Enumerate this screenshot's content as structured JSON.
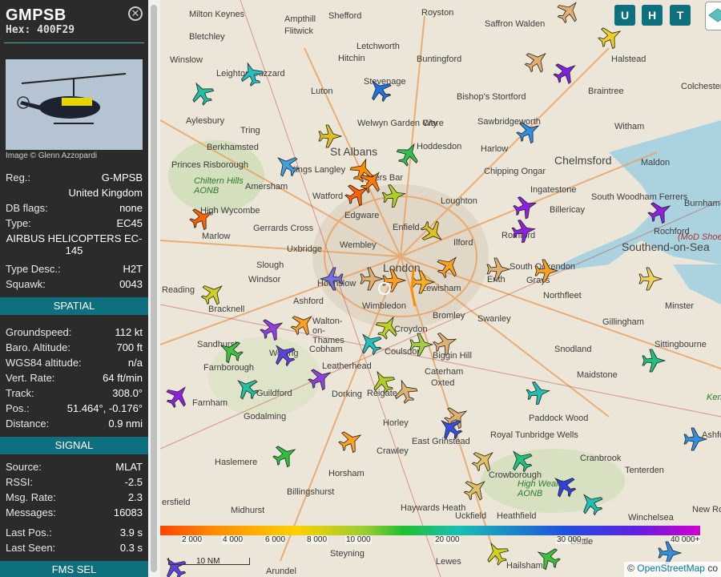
{
  "aircraft": {
    "callsign": "GMPSB",
    "hex_label": "Hex: 400F29",
    "image_credit": "Image © Glenn Azzopardi",
    "details": [
      {
        "key": "Reg.:",
        "value": "G-MPSB"
      },
      {
        "key": "",
        "value": "United Kingdom"
      },
      {
        "key": "DB flags:",
        "value": "none"
      },
      {
        "key": "Type:",
        "value": "EC45"
      },
      {
        "key": "",
        "value": "AIRBUS HELICOPTERS EC-145"
      },
      {
        "key": "Type Desc.:",
        "value": "H2T"
      },
      {
        "key": "Squawk:",
        "value": "0043"
      }
    ]
  },
  "spatial": {
    "header": "SPATIAL",
    "rows": [
      {
        "key": "Groundspeed:",
        "value": "112 kt"
      },
      {
        "key": "Baro. Altitude:",
        "value": "700 ft"
      },
      {
        "key": "WGS84 altitude:",
        "value": "n/a"
      },
      {
        "key": "Vert. Rate:",
        "value": "64 ft/min"
      },
      {
        "key": "Track:",
        "value": "308.0°"
      },
      {
        "key": "Pos.:",
        "value": "51.464°, -0.176°"
      },
      {
        "key": "Distance:",
        "value": "0.9 nmi"
      }
    ]
  },
  "signal": {
    "header": "SIGNAL",
    "rows": [
      {
        "key": "Source:",
        "value": "MLAT"
      },
      {
        "key": "RSSI:",
        "value": "-2.5"
      },
      {
        "key": "Msg. Rate:",
        "value": "2.3"
      },
      {
        "key": "Messages:",
        "value": "16083"
      },
      {
        "key": "Last Pos.:",
        "value": "3.9 s"
      },
      {
        "key": "Last Seen:",
        "value": "0.3 s"
      }
    ]
  },
  "fms": {
    "header": "FMS SEL"
  },
  "map_buttons": {
    "u": "U",
    "h": "H",
    "t": "T"
  },
  "altitude_legend": [
    "2 000",
    "4 000",
    "6 000",
    "8 000",
    "10 000",
    "20 000",
    "30 000",
    "40 000+"
  ],
  "scale_label": "10 NM",
  "attribution": {
    "prefix": "©",
    "link": "OpenStreetMap",
    "suffix": "co"
  },
  "map_labels": {
    "milton_keynes": "Milton Keynes",
    "ampthill": "Ampthill",
    "shefford": "Shefford",
    "royston": "Royston",
    "saffron_walden": "Saffron Walden",
    "bletchley": "Bletchley",
    "flitwick": "Flitwick",
    "halstead": "Halstead",
    "winslow": "Winslow",
    "hitchin": "Hitchin",
    "letchworth": "Letchworth",
    "buntingford": "Buntingford",
    "colchester": "Colchester",
    "leighton_buzzard": "Leighton Buzzard",
    "luton": "Luton",
    "stevenage": "Stevenage",
    "bishops_stortford": "Bishop's Stortford",
    "braintree": "Braintree",
    "aylesbury": "Aylesbury",
    "welwyn": "Welwyn Garden City",
    "ware": "Ware",
    "sawbridgeworth": "Sawbridgeworth",
    "witham": "Witham",
    "tring": "Tring",
    "st_albans": "St Albans",
    "hoddesdon": "Hoddesdon",
    "harlow": "Harlow",
    "berkhamsted": "Berkhamsted",
    "chelmsford": "Chelmsford",
    "princes_risborough": "Princes Risborough",
    "kings_langley": "Kings Langley",
    "chipping_ongar": "Chipping Ongar",
    "maldon": "Maldon",
    "chiltern": "Chiltern Hills AONB",
    "amersham": "Amersham",
    "potters_bar": "Potters Bar",
    "ingatestone": "Ingatestone",
    "high_wycombe": "High Wycombe",
    "watford": "Watford",
    "loughton": "Loughton",
    "south_woodham": "South Woodham Ferrers",
    "burnham": "Burnham-on-Crouch",
    "edgware": "Edgware",
    "billericay": "Billericay",
    "marlow": "Marlow",
    "gerrards_cross": "Gerrards Cross",
    "enfield": "Enfield",
    "rochford": "Rochford",
    "mod_shoebury": "(MoD Shoebury)",
    "wembley": "Wembley",
    "ilford": "Ilford",
    "romford": "Romford",
    "uxbridge": "Uxbridge",
    "southend": "Southend-on-Sea",
    "slough": "Slough",
    "london": "London",
    "ockendon": "South Ockendon",
    "windsor": "Windsor",
    "hounslow": "Hounslow",
    "grays": "Grays",
    "reading": "Reading",
    "wimbledon": "Wimbledon",
    "lewisham": "Lewisham",
    "erith": "Erith",
    "northfleet": "Northfleet",
    "bracknell": "Bracknell",
    "ashford": "Ashford",
    "bromley": "Bromley",
    "swanley": "Swanley",
    "gillingham": "Gillingham",
    "minster": "Minster",
    "walton": "Walton-on-Thames",
    "croydon": "Croydon",
    "sandhurst": "Sandhurst",
    "cobham": "Cobham",
    "coulsdon": "Coulsdon",
    "biggin_hill": "Biggin Hill",
    "snodland": "Snodland",
    "sittingbourne": "Sittingbourne",
    "farnborough": "Farnborough",
    "woking": "Woking",
    "leatherhead": "Leatherhead",
    "caterham": "Caterham",
    "oxted": "Oxted",
    "maidstone": "Maidstone",
    "guildford": "Guildford",
    "dorking": "Dorking",
    "reigate": "Reigate",
    "farnham": "Farnham",
    "kent": "Kent",
    "godalming": "Godalming",
    "horley": "Horley",
    "paddock_wood": "Paddock Wood",
    "east_grinstead": "East Grinstead",
    "royal_tunbridge": "Royal Tunbridge Wells",
    "ashford_kent": "Ashford",
    "haslemere": "Haslemere",
    "crawley": "Crawley",
    "cranbrook": "Cranbrook",
    "tenterden": "Tenterden",
    "crowborough": "Crowborough",
    "high_weald": "High Weald AONB",
    "billingshurst": "Billingshurst",
    "horsham": "Horsham",
    "haywards_heath": "Haywards Heath",
    "uckfield": "Uckfield",
    "heathfield": "Heathfield",
    "midhurst": "Midhurst",
    "new_romney": "New Rom",
    "ersfield": "ersfield",
    "winchelsea": "Winchelsea",
    "battle": "Battle",
    "lewes": "Lewes",
    "steyning": "Steyning",
    "hailsham": "Hailsham",
    "arundel": "Arundel"
  }
}
